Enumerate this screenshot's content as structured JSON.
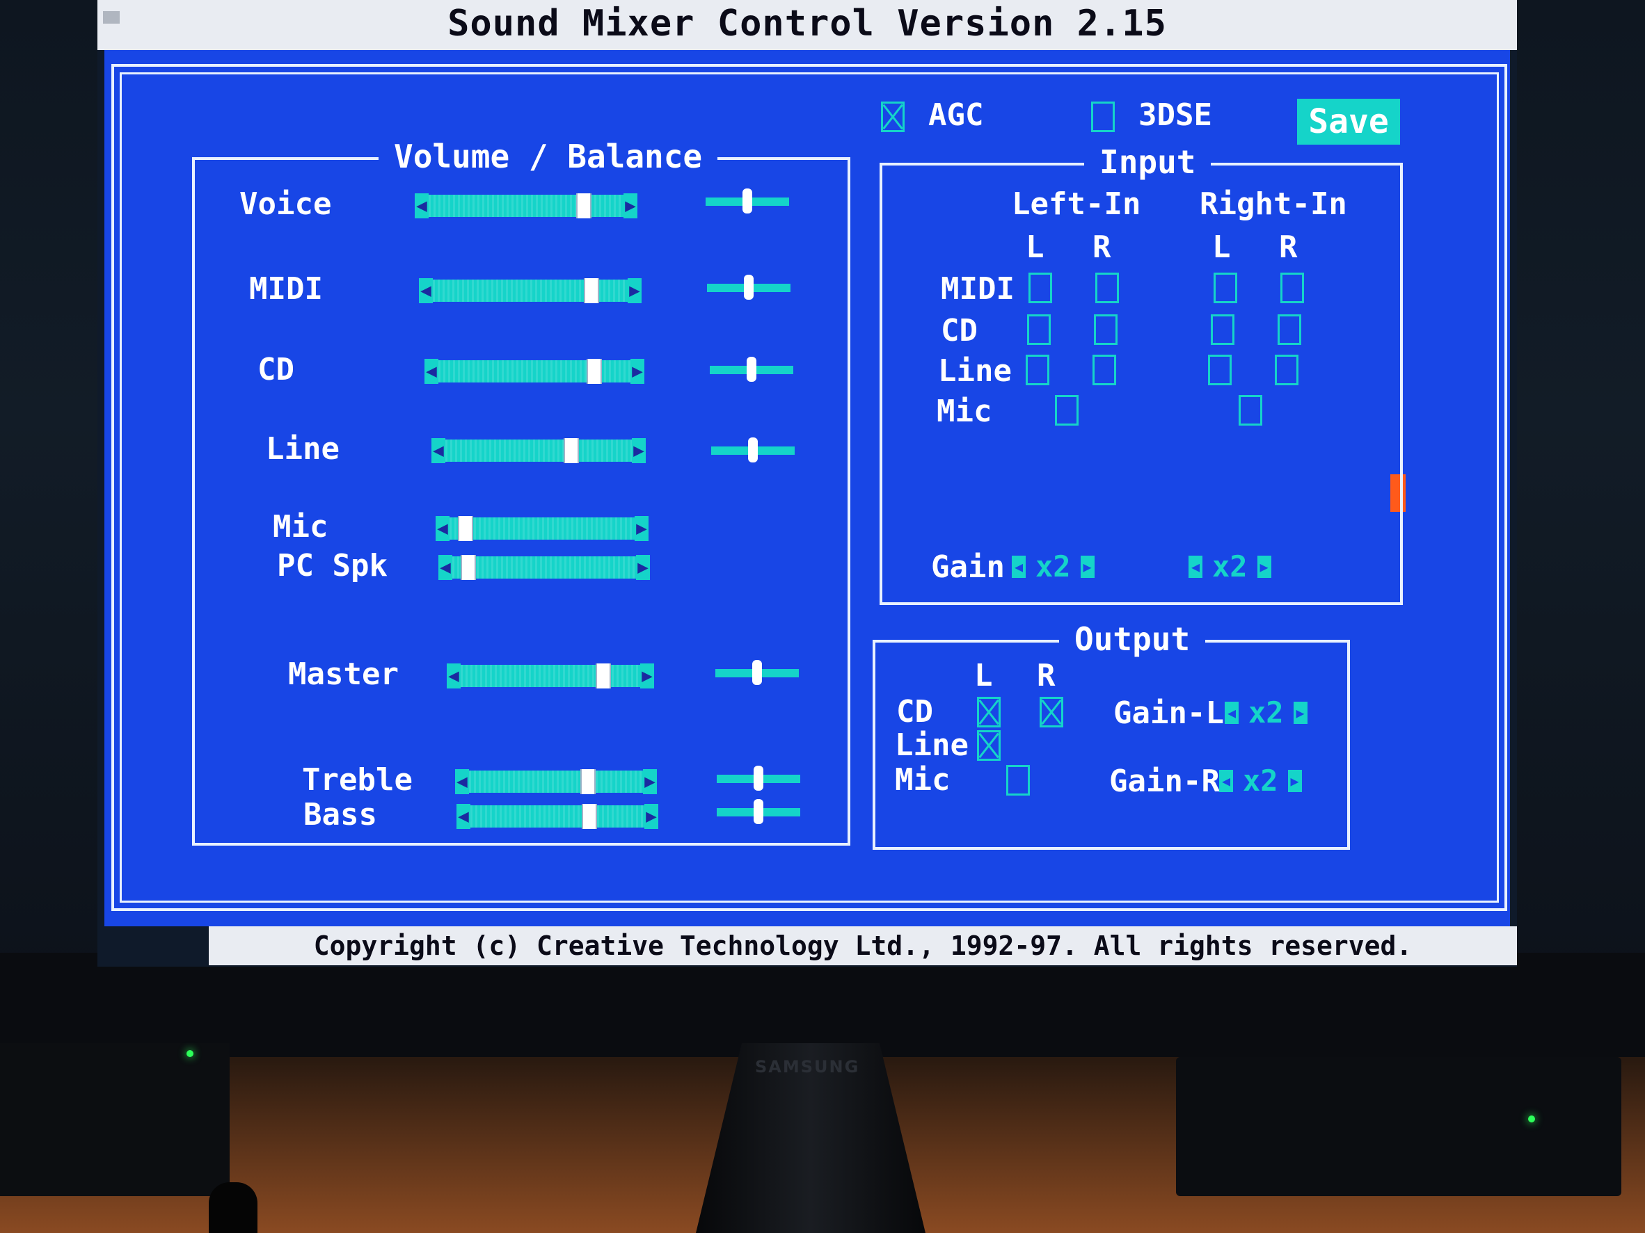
{
  "window": {
    "title": "Sound Mixer Control Version 2.15"
  },
  "footer": {
    "copyright": "Copyright (c) Creative Technology Ltd., 1992-97. All rights reserved."
  },
  "toolbar": {
    "agc": {
      "label": "AGC",
      "checked": true
    },
    "threedse": {
      "label": "3DSE",
      "checked": false
    },
    "save_label": "Save"
  },
  "volume_panel": {
    "title": "Volume / Balance",
    "rows": [
      {
        "label": "Voice",
        "level": 0.82,
        "balance": 0.5
      },
      {
        "label": "MIDI",
        "level": 0.84,
        "balance": 0.5
      },
      {
        "label": "CD",
        "level": 0.84,
        "balance": 0.5
      },
      {
        "label": "Line",
        "level": 0.69,
        "balance": 0.5
      },
      {
        "label": "Mic",
        "level": 0.05
      },
      {
        "label": "PC Spk",
        "level": 0.05
      },
      {
        "label": "Master",
        "level": 0.82,
        "balance": 0.5
      },
      {
        "label": "Treble",
        "level": 0.7,
        "balance": 0.5
      },
      {
        "label": "Bass",
        "level": 0.7,
        "balance": 0.5
      }
    ]
  },
  "input_panel": {
    "title": "Input",
    "left_in": "Left-In",
    "right_in": "Right-In",
    "l": "L",
    "r": "R",
    "rows": [
      {
        "label": "MIDI"
      },
      {
        "label": "CD"
      },
      {
        "label": "Line"
      },
      {
        "label": "Mic"
      }
    ],
    "gain_label": "Gain",
    "gain_left": "x2",
    "gain_right": "x2"
  },
  "output_panel": {
    "title": "Output",
    "l": "L",
    "r": "R",
    "rows": [
      {
        "label": "CD",
        "l": true,
        "r": true
      },
      {
        "label": "Line",
        "l": true
      },
      {
        "label": "Mic",
        "l": false
      }
    ],
    "gain_l_label": "Gain-L",
    "gain_l_value": "x2",
    "gain_r_label": "Gain-R",
    "gain_r_value": "x2"
  },
  "monitor": {
    "brand": "SAMSUNG"
  },
  "colors": {
    "background": "#1846e6",
    "accent": "#15d4c9",
    "frame": "#e8f1ff"
  }
}
